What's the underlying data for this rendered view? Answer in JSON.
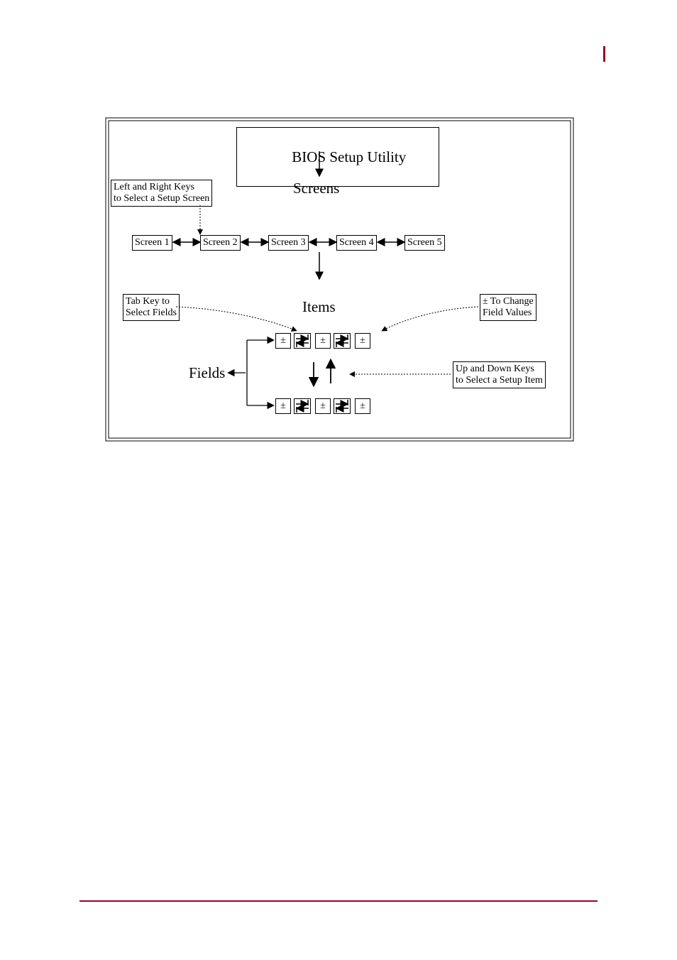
{
  "title": "BIOS Setup Utility",
  "labels": {
    "screens": "Screens",
    "items": "Items",
    "fields": "Fields"
  },
  "hints": {
    "left_right": "Left and Right Keys\nto Select a Setup Screen",
    "tab": "Tab Key to\nSelect Fields",
    "plus_minus": "± To Change\nField Values",
    "up_down": "Up and Down Keys\nto Select a Setup Item"
  },
  "screens": [
    "Screen 1",
    "Screen 2",
    "Screen 3",
    "Screen 4",
    "Screen 5"
  ],
  "symbol_pm": "±"
}
